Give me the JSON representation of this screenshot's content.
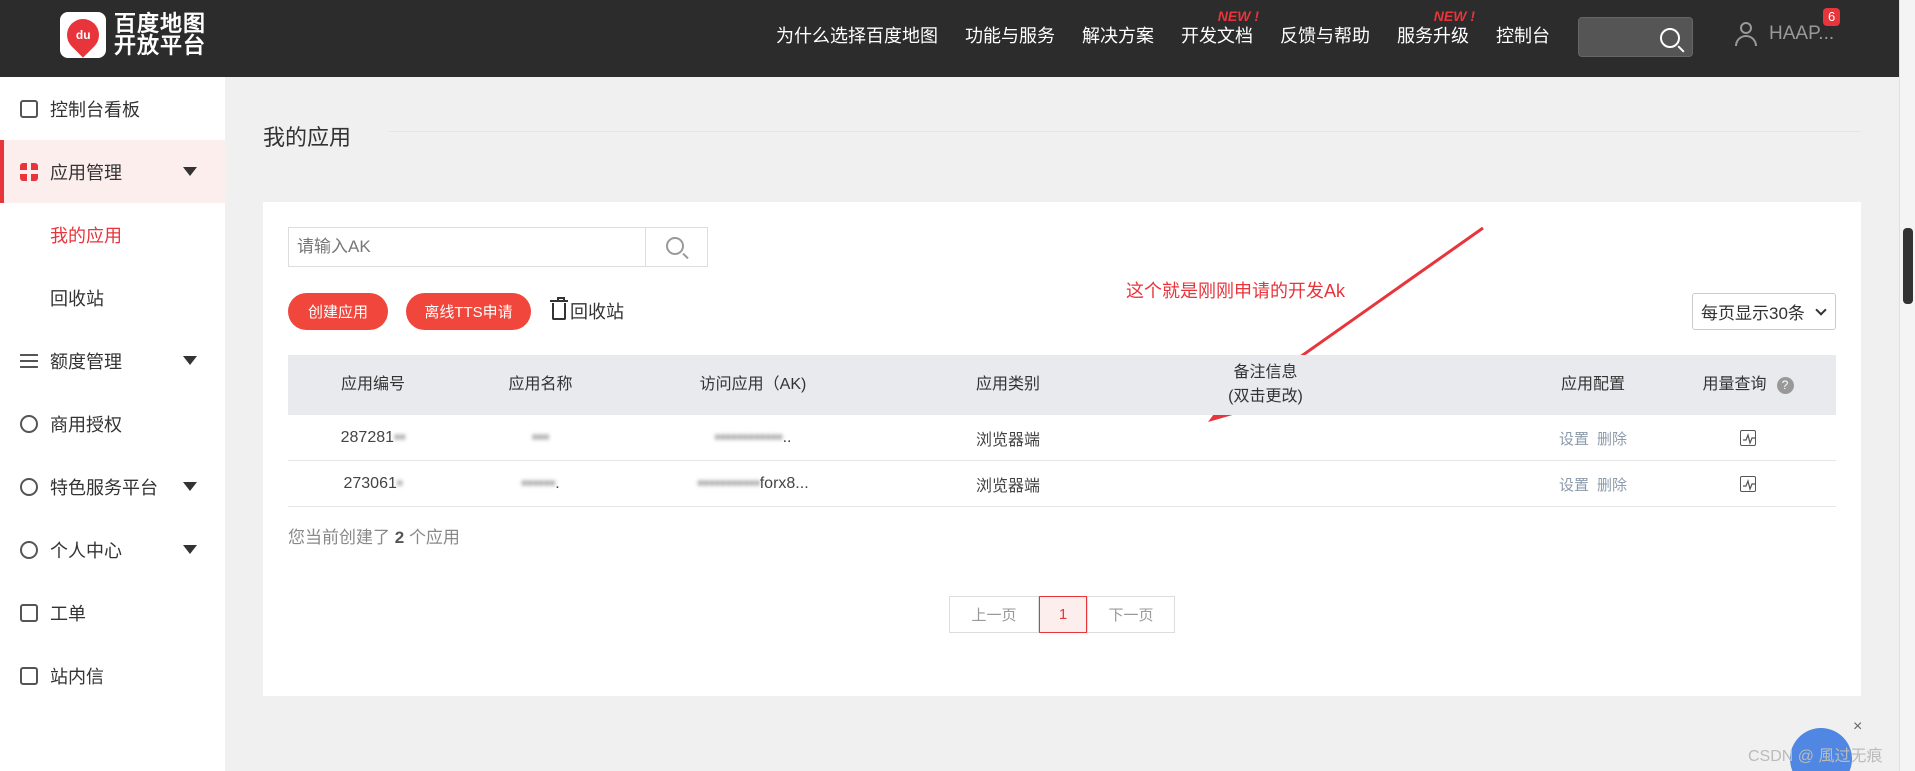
{
  "header": {
    "logo_badge": "du",
    "logo_line1": "百度地图",
    "logo_line2": "开放平台",
    "nav": [
      {
        "label": "为什么选择百度地图",
        "tag": ""
      },
      {
        "label": "功能与服务",
        "tag": ""
      },
      {
        "label": "解决方案",
        "tag": ""
      },
      {
        "label": "开发文档",
        "tag": "NEW !"
      },
      {
        "label": "反馈与帮助",
        "tag": ""
      },
      {
        "label": "服务升级",
        "tag": "NEW !"
      },
      {
        "label": "控制台",
        "tag": ""
      }
    ],
    "username": "HAAP...",
    "notification_count": "6"
  },
  "sidebar": {
    "items": [
      {
        "label": "控制台看板"
      },
      {
        "label": "应用管理"
      },
      {
        "label": "我的应用"
      },
      {
        "label": "回收站"
      },
      {
        "label": "额度管理"
      },
      {
        "label": "商用授权"
      },
      {
        "label": "特色服务平台"
      },
      {
        "label": "个人中心"
      },
      {
        "label": "工单"
      },
      {
        "label": "站内信"
      }
    ]
  },
  "main": {
    "title": "我的应用",
    "search_placeholder": "请输入AK",
    "create_button": "创建应用",
    "tts_button": "离线TTS申请",
    "recycle_label": "回收站",
    "per_page": "每页显示30条",
    "annotation": "这个就是刚刚申请的开发Ak",
    "table": {
      "headers": [
        "应用编号",
        "应用名称",
        "访问应用（AK)",
        "应用类别",
        "备注信息",
        "(双击更改)",
        "应用配置",
        "用量查询"
      ],
      "rows": [
        {
          "id": "287281",
          "id_masked": "▪▪",
          "name_masked": "▪▪▪",
          "ak_masked": "▪▪▪▪▪▪▪▪▪▪▪▪",
          "ak_suffix": "..",
          "category": "浏览器端",
          "settings": "设置",
          "delete": "删除"
        },
        {
          "id": "273061",
          "id_masked": "▪",
          "name_masked": "▪▪▪▪▪▪",
          "name_suffix": ".",
          "ak_masked": "▪▪▪▪▪▪▪▪▪▪▪",
          "ak_suffix": "forx8...",
          "category": "浏览器端",
          "settings": "设置",
          "delete": "删除"
        }
      ]
    },
    "count_prefix": "您当前创建了",
    "count": "2",
    "count_suffix": "个应用",
    "pager": {
      "prev": "上一页",
      "current": "1",
      "next": "下一页"
    }
  },
  "watermark": "CSDN @ 風过无痕"
}
